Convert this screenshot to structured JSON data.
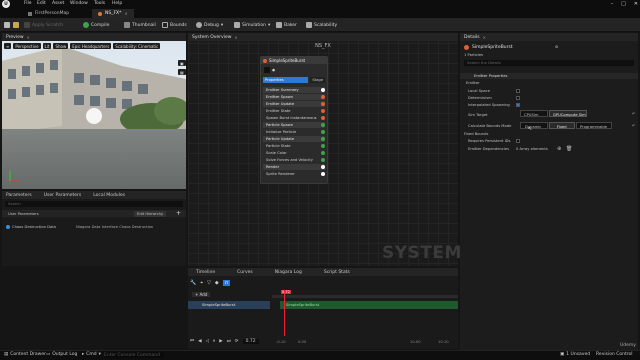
{
  "menu": [
    "File",
    "Edit",
    "Asset",
    "Window",
    "Tools",
    "Help"
  ],
  "tabs": [
    {
      "label": "FirstPersonMap",
      "active": false
    },
    {
      "label": "NS_FX*",
      "active": true
    }
  ],
  "toolbar": {
    "apply_label": "Apply Scratch",
    "compile_label": "Compile",
    "thumbnail_label": "Thumbnail",
    "bounds_label": "Bounds",
    "debug_label": "Debug",
    "simulation_label": "Simulation",
    "baker_label": "Baker",
    "scalability_label": "Scalability"
  },
  "preview": {
    "tab_label": "Preview",
    "perspective_label": "Perspective",
    "lit_label": "Lit",
    "show_label": "Show",
    "headquarters_label": "Epic Headquarters",
    "scalability_label": "Scalability: Cinematic"
  },
  "graph": {
    "tab_label": "System Overview",
    "title": "NS_FX",
    "watermark": "SYSTEM",
    "emitter": {
      "name": "SimpleSpriteBurst",
      "properties_label": "Properties",
      "stage_label": "Stage",
      "rows": [
        {
          "label": "Emitter Summary",
          "section": true,
          "color": "#ffffff"
        },
        {
          "label": "Emitter Spawn",
          "section": true,
          "color": "#e06030"
        },
        {
          "label": "Emitter Update",
          "section": true,
          "color": "#e06030"
        },
        {
          "label": "Emitter State",
          "section": false,
          "color": "#e06030"
        },
        {
          "label": "Spawn Burst Instantaneous",
          "section": false,
          "color": "#e06030"
        },
        {
          "label": "Particle Spawn",
          "section": true,
          "color": "#3fa34d"
        },
        {
          "label": "Initialize Particle",
          "section": false,
          "color": "#3fa34d"
        },
        {
          "label": "Particle Update",
          "section": true,
          "color": "#3fa34d"
        },
        {
          "label": "Particle State",
          "section": false,
          "color": "#3fa34d"
        },
        {
          "label": "Scale Color",
          "section": false,
          "color": "#3fa34d"
        },
        {
          "label": "Solve Forces and Velocity",
          "section": false,
          "color": "#3fa34d"
        },
        {
          "label": "Render",
          "section": true,
          "color": "#ffffff"
        },
        {
          "label": "Sprite Renderer",
          "section": false,
          "color": "#ffffff"
        }
      ]
    }
  },
  "details": {
    "tab_label": "Details",
    "emitter_name": "SimpleSpriteBurst",
    "particles_label": "1 Particles",
    "search_placeholder": "Search the Details",
    "section_label": "Emitter Properties",
    "subsection_label": "Emitter",
    "local_space_label": "Local Space",
    "determinism_label": "Determinism",
    "interpolated_label": "Interpolated Spawning",
    "sim_target_label": "Sim Target",
    "sim_target_cpu": "CPUSim",
    "sim_target_gpu": "GPUCompute Sim",
    "calc_bounds_label": "Calculate Bounds Mode",
    "bounds_dynamic": "Dynamic",
    "bounds_fixed": "Fixed",
    "bounds_programmable": "Programmable",
    "fixed_bounds_label": "Fixed Bounds",
    "persistent_ids_label": "Requires Persistent IDs",
    "dependencies_label": "Emitter Dependencies",
    "dependencies_value": "0 Array elements"
  },
  "params": {
    "tab_parameters": "Parameters",
    "tab_user": "User Parameters",
    "tab_modules": "Local Modules",
    "search_placeholder": "Search",
    "section_label": "User Parameters",
    "edit_hierarchy_label": "Edit Hierarchy",
    "item_name": "Chaos Destruction Data",
    "item_value": "Niagara Data Interface Chaos Destruction"
  },
  "timeline": {
    "tabs": [
      "Timeline",
      "Curves",
      "Niagara Log",
      "Script Stats"
    ],
    "add_label": "+ Add",
    "track_label": "SimpleSpriteBurst",
    "segment_label": "SimpleSpriteBurst",
    "playhead": "0.72",
    "start": "-0.10",
    "start2": "0.00",
    "end": "10.00",
    "end2": "10.10",
    "time_field": "0.72"
  },
  "statusbar": {
    "content_drawer": "Content Drawer",
    "output_log": "Output Log",
    "cmd": "Cmd",
    "console_placeholder": "Enter Console Command",
    "unsaved": "1 Unsaved",
    "revision": "Revision Control",
    "udemy": "Udemy"
  },
  "accent": "#2d7ad6"
}
